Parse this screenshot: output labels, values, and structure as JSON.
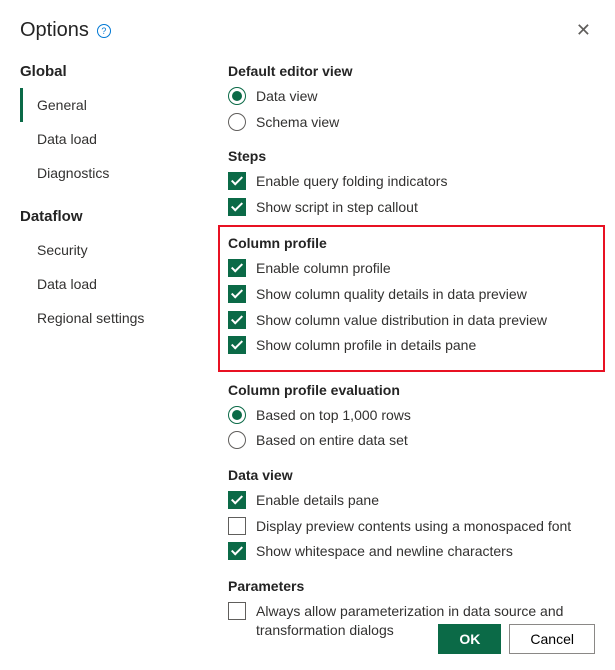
{
  "dialog": {
    "title": "Options"
  },
  "sidebar": {
    "groups": [
      {
        "title": "Global",
        "items": [
          "General",
          "Data load",
          "Diagnostics"
        ],
        "activeIndex": 0
      },
      {
        "title": "Dataflow",
        "items": [
          "Security",
          "Data load",
          "Regional settings"
        ],
        "activeIndex": -1
      }
    ]
  },
  "sections": {
    "defaultEditorView": {
      "title": "Default editor view",
      "options": [
        "Data view",
        "Schema view"
      ]
    },
    "steps": {
      "title": "Steps",
      "options": [
        "Enable query folding indicators",
        "Show script in step callout"
      ]
    },
    "columnProfile": {
      "title": "Column profile",
      "options": [
        "Enable column profile",
        "Show column quality details in data preview",
        "Show column value distribution in data preview",
        "Show column profile in details pane"
      ]
    },
    "columnProfileEval": {
      "title": "Column profile evaluation",
      "options": [
        "Based on top 1,000 rows",
        "Based on entire data set"
      ]
    },
    "dataView": {
      "title": "Data view",
      "options": [
        "Enable details pane",
        "Display preview contents using a monospaced font",
        "Show whitespace and newline characters"
      ]
    },
    "parameters": {
      "title": "Parameters",
      "options": [
        "Always allow parameterization in data source and transformation dialogs"
      ]
    }
  },
  "footer": {
    "ok": "OK",
    "cancel": "Cancel"
  }
}
